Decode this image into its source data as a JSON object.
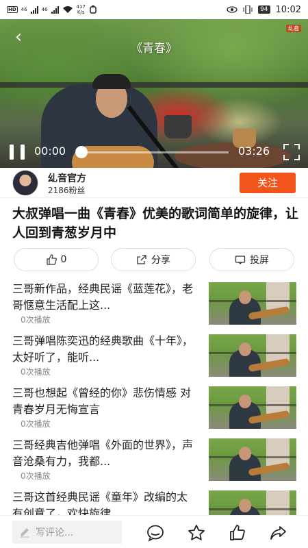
{
  "status_bar": {
    "left_labels": [
      "HD",
      "46",
      "46"
    ],
    "speed": "417\nK/s",
    "speed_value": "417",
    "speed_unit": "K/s",
    "battery": "94",
    "time": "10:02"
  },
  "video": {
    "title": "《青春》",
    "watermark": "乣音",
    "current_time": "00:00",
    "total_time": "03:26",
    "progress": 0.0,
    "icons": [
      "back-icon",
      "pause-icon",
      "fullscreen-icon"
    ]
  },
  "author": {
    "name": "乣音官方",
    "fans": "2186粉丝",
    "follow_label": "关注"
  },
  "video_title": "大叔弹唱一曲《青春》优美的歌词简单的旋律，让人回到青葱岁月中",
  "actions": {
    "like_count": "0",
    "share_label": "分享",
    "cast_label": "投屏"
  },
  "related": [
    {
      "title": "三哥新作品，经典民谣《蓝莲花》，老哥惬意生活配上这...",
      "views": "0次播放"
    },
    {
      "title": "三哥弹唱陈奕迅的经典歌曲《十年》，太好听了，能听...",
      "views": "0次播放"
    },
    {
      "title": "三哥也想起《曾经的你》悲伤情感 对青春岁月无悔宣言",
      "views": "0次播放"
    },
    {
      "title": "三哥经典吉他弹唱《外面的世界》，声音沧桑有力，我都...",
      "views": "0次播放"
    },
    {
      "title": "三哥这首经典民谣《童年》改编的太有创意了，欢快旋律...",
      "views": ""
    }
  ],
  "bottom_bar": {
    "comment_placeholder": "写评论...",
    "icons": [
      "comment-icon",
      "star-icon",
      "thumbs-up-icon",
      "share-arrow-icon"
    ]
  },
  "colors": {
    "accent": "#f2541b",
    "text": "#111111",
    "muted": "#888888"
  }
}
